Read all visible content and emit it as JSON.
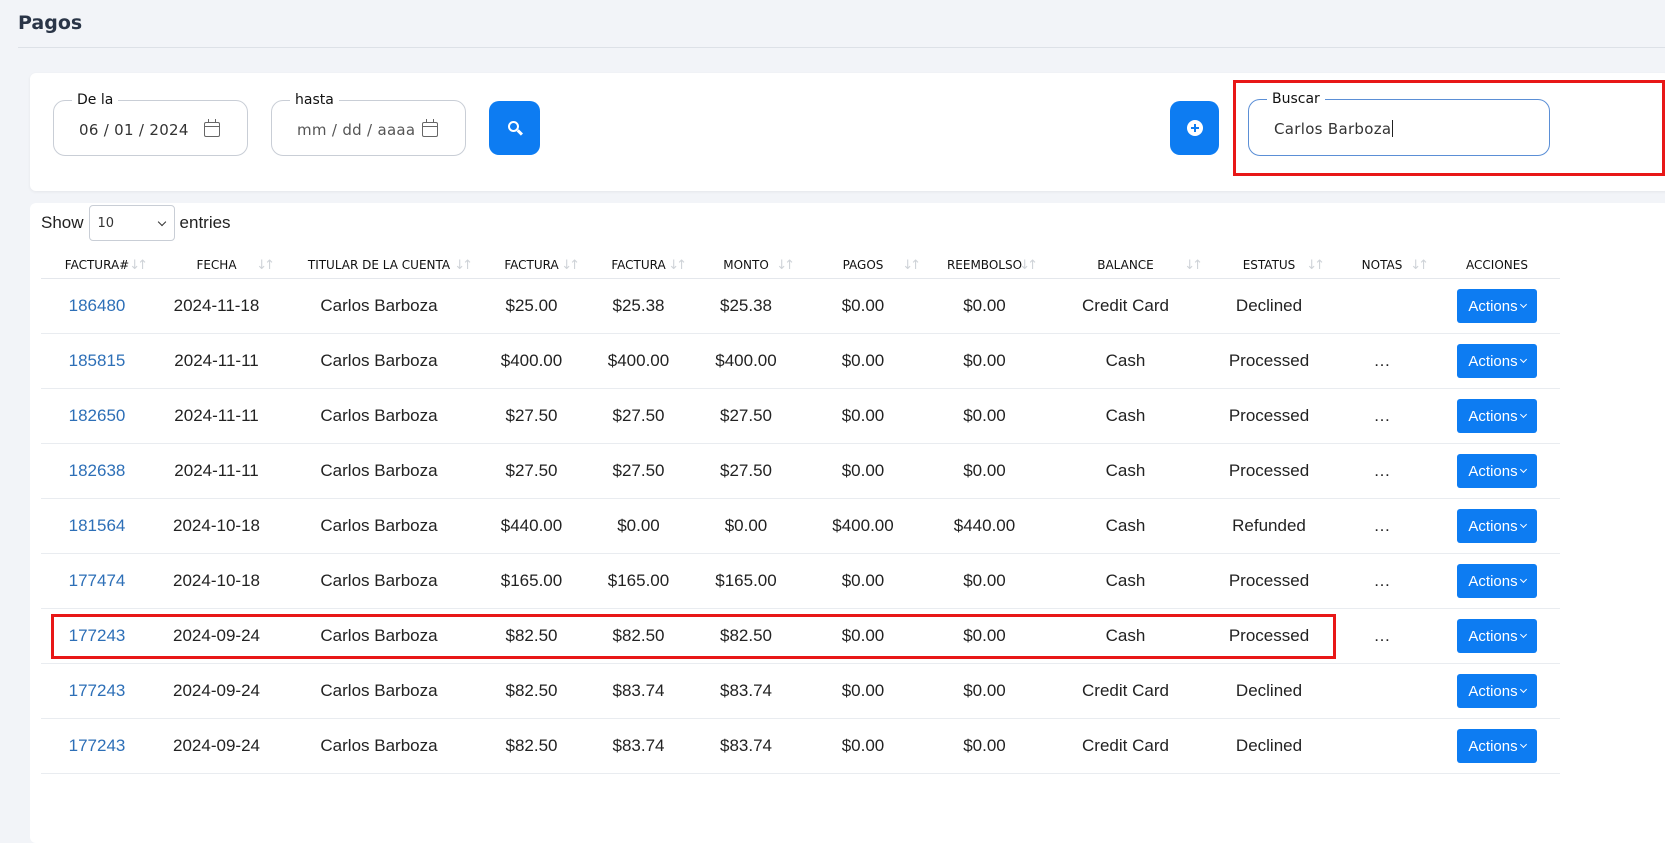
{
  "page": {
    "title": "Pagos"
  },
  "filters": {
    "from": {
      "label": "De la",
      "value": "06 / 01 / 2024"
    },
    "to": {
      "label": "hasta",
      "placeholder": "mm / dd / aaaa"
    },
    "search": {
      "label": "Buscar",
      "value": "Carlos Barboza"
    }
  },
  "table_controls": {
    "show_label": "Show",
    "page_size": "10",
    "entries_label": "entries"
  },
  "table": {
    "columns": [
      "FACTURA#",
      "FECHA",
      "TITULAR DE LA CUENTA",
      "FACTURA",
      "FACTURA",
      "MONTO",
      "PAGOS",
      "REEMBOLSO",
      "BALANCE",
      "ESTATUS",
      "NOTAS",
      "ACCIONES"
    ],
    "action_label": "Actions",
    "rows": [
      {
        "id": "186480",
        "date": "2024-11-18",
        "holder": "Carlos Barboza",
        "factura1": "$25.00",
        "factura2": "$25.38",
        "monto": "$25.38",
        "pagos": "$0.00",
        "reembolso": "$0.00",
        "balance": "Credit Card",
        "status": "Declined",
        "notes": ""
      },
      {
        "id": "185815",
        "date": "2024-11-11",
        "holder": "Carlos Barboza",
        "factura1": "$400.00",
        "factura2": "$400.00",
        "monto": "$400.00",
        "pagos": "$0.00",
        "reembolso": "$0.00",
        "balance": "Cash",
        "status": "Processed",
        "notes": "…"
      },
      {
        "id": "182650",
        "date": "2024-11-11",
        "holder": "Carlos Barboza",
        "factura1": "$27.50",
        "factura2": "$27.50",
        "monto": "$27.50",
        "pagos": "$0.00",
        "reembolso": "$0.00",
        "balance": "Cash",
        "status": "Processed",
        "notes": "…"
      },
      {
        "id": "182638",
        "date": "2024-11-11",
        "holder": "Carlos Barboza",
        "factura1": "$27.50",
        "factura2": "$27.50",
        "monto": "$27.50",
        "pagos": "$0.00",
        "reembolso": "$0.00",
        "balance": "Cash",
        "status": "Processed",
        "notes": "…"
      },
      {
        "id": "181564",
        "date": "2024-10-18",
        "holder": "Carlos Barboza",
        "factura1": "$440.00",
        "factura2": "$0.00",
        "monto": "$0.00",
        "pagos": "$400.00",
        "reembolso": "$440.00",
        "balance": "Cash",
        "status": "Refunded",
        "notes": "…"
      },
      {
        "id": "177474",
        "date": "2024-10-18",
        "holder": "Carlos Barboza",
        "factura1": "$165.00",
        "factura2": "$165.00",
        "monto": "$165.00",
        "pagos": "$0.00",
        "reembolso": "$0.00",
        "balance": "Cash",
        "status": "Processed",
        "notes": "…"
      },
      {
        "id": "177243",
        "date": "2024-09-24",
        "holder": "Carlos Barboza",
        "factura1": "$82.50",
        "factura2": "$82.50",
        "monto": "$82.50",
        "pagos": "$0.00",
        "reembolso": "$0.00",
        "balance": "Cash",
        "status": "Processed",
        "notes": "…"
      },
      {
        "id": "177243",
        "date": "2024-09-24",
        "holder": "Carlos Barboza",
        "factura1": "$82.50",
        "factura2": "$83.74",
        "monto": "$83.74",
        "pagos": "$0.00",
        "reembolso": "$0.00",
        "balance": "Credit Card",
        "status": "Declined",
        "notes": ""
      },
      {
        "id": "177243",
        "date": "2024-09-24",
        "holder": "Carlos Barboza",
        "factura1": "$82.50",
        "factura2": "$83.74",
        "monto": "$83.74",
        "pagos": "$0.00",
        "reembolso": "$0.00",
        "balance": "Credit Card",
        "status": "Declined",
        "notes": ""
      }
    ]
  },
  "icons": {
    "from_calendar": "calendar-icon",
    "to_calendar": "calendar-icon",
    "search_button": "search-icon",
    "add_button": "plus-circle-icon",
    "sort": "sort-icon",
    "actions_dropdown": "chevron-down-icon"
  },
  "colors": {
    "primary": "#0d7cf2",
    "link": "#2d6fb7",
    "highlight": "#e81717",
    "background": "#f2f4f8"
  }
}
